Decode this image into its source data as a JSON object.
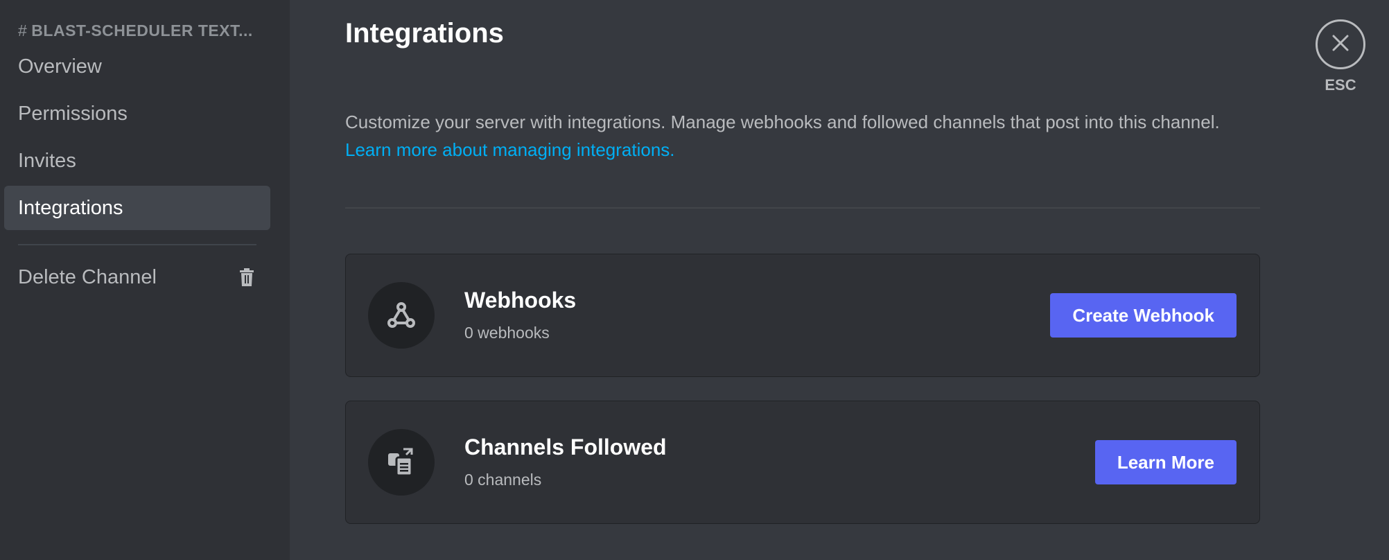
{
  "sidebar": {
    "header_prefix": "#",
    "header": "BLAST-SCHEDULER TEXT...",
    "items": [
      {
        "label": "Overview"
      },
      {
        "label": "Permissions"
      },
      {
        "label": "Invites"
      },
      {
        "label": "Integrations",
        "active": true
      }
    ],
    "delete_label": "Delete Channel"
  },
  "main": {
    "title": "Integrations",
    "description": "Customize your server with integrations. Manage webhooks and followed channels that post into this channel.",
    "learn_more_link": "Learn more about managing integrations.",
    "cards": [
      {
        "title": "Webhooks",
        "subtitle": "0 webhooks",
        "button": "Create Webhook",
        "icon": "webhook-icon"
      },
      {
        "title": "Channels Followed",
        "subtitle": "0 channels",
        "button": "Learn More",
        "icon": "channels-followed-icon"
      }
    ]
  },
  "close": {
    "label": "ESC"
  },
  "colors": {
    "accent": "#5865f2",
    "link": "#00aff4",
    "background": "#36393f",
    "sidebar": "#2f3136"
  }
}
